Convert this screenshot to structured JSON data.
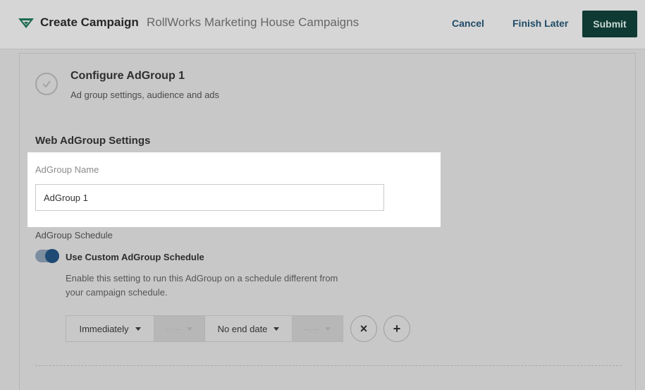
{
  "header": {
    "title": "Create Campaign",
    "subtitle": "RollWorks Marketing House Campaigns",
    "cancel_label": "Cancel",
    "finish_later_label": "Finish Later",
    "submit_label": "Submit"
  },
  "section": {
    "title": "Configure AdGroup 1",
    "subtitle": "Ad group settings, audience and ads"
  },
  "settings": {
    "title": "Web AdGroup Settings",
    "name_label": "AdGroup Name",
    "name_value": "AdGroup 1",
    "schedule_label": "AdGroup Schedule",
    "toggle_label": "Use Custom AdGroup Schedule",
    "toggle_on": true,
    "description": "Enable this setting to run this AdGroup on a schedule different from your campaign schedule."
  },
  "schedule": {
    "start_label": "Immediately",
    "start_time": "--:--",
    "end_label": "No end date",
    "end_time": "--:--",
    "remove_symbol": "×",
    "add_symbol": "+"
  },
  "colors": {
    "brand": "#0e3a33",
    "link": "#1f4b66",
    "toggle": "#1e4a73"
  }
}
